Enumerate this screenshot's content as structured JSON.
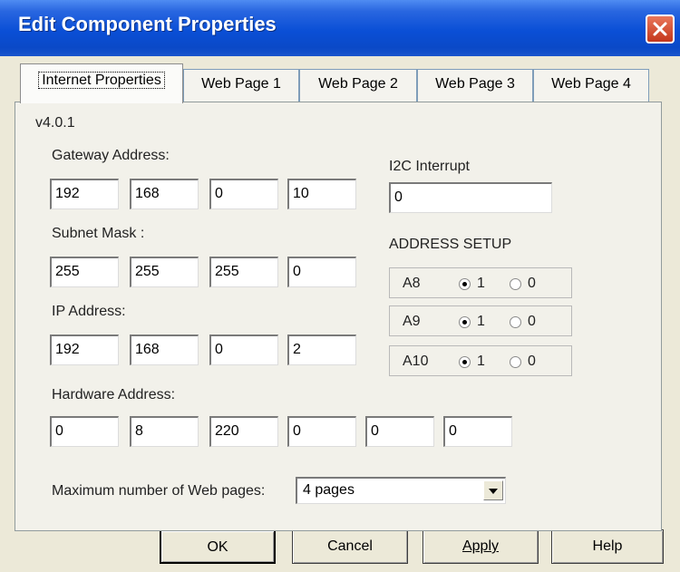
{
  "window": {
    "title": "Edit Component Properties"
  },
  "tabs": [
    {
      "label": "Internet Properties"
    },
    {
      "label": "Web Page 1"
    },
    {
      "label": "Web Page 2"
    },
    {
      "label": "Web Page 3"
    },
    {
      "label": "Web Page 4"
    }
  ],
  "version": "v4.0.1",
  "gateway": {
    "label": "Gateway Address:",
    "values": [
      "192",
      "168",
      "0",
      "10"
    ]
  },
  "subnet": {
    "label": "Subnet Mask :",
    "values": [
      "255",
      "255",
      "255",
      "0"
    ]
  },
  "ip": {
    "label": "IP Address:",
    "values": [
      "192",
      "168",
      "0",
      "2"
    ]
  },
  "hardware": {
    "label": "Hardware Address:",
    "values": [
      "0",
      "8",
      "220",
      "0",
      "0",
      "0"
    ]
  },
  "i2c": {
    "label": "I2C Interrupt",
    "value": "0"
  },
  "address_setup": {
    "label": "ADDRESS SETUP",
    "rows": [
      {
        "name": "A8",
        "opt1": "1",
        "opt0": "0",
        "selected": "1"
      },
      {
        "name": "A9",
        "opt1": "1",
        "opt0": "0",
        "selected": "1"
      },
      {
        "name": "A10",
        "opt1": "1",
        "opt0": "0",
        "selected": "1"
      }
    ]
  },
  "max_pages": {
    "label": "Maximum number of Web pages:",
    "value": "4 pages"
  },
  "buttons": {
    "ok": "OK",
    "cancel": "Cancel",
    "apply": "Apply",
    "help": "Help"
  },
  "colors": {
    "title_bar": "#0a4fd6",
    "dialog_bg": "#ece9d8",
    "close_button": "#d4502f"
  },
  "icons": {
    "close": "close-icon",
    "dropdown": "chevron-down-icon"
  }
}
